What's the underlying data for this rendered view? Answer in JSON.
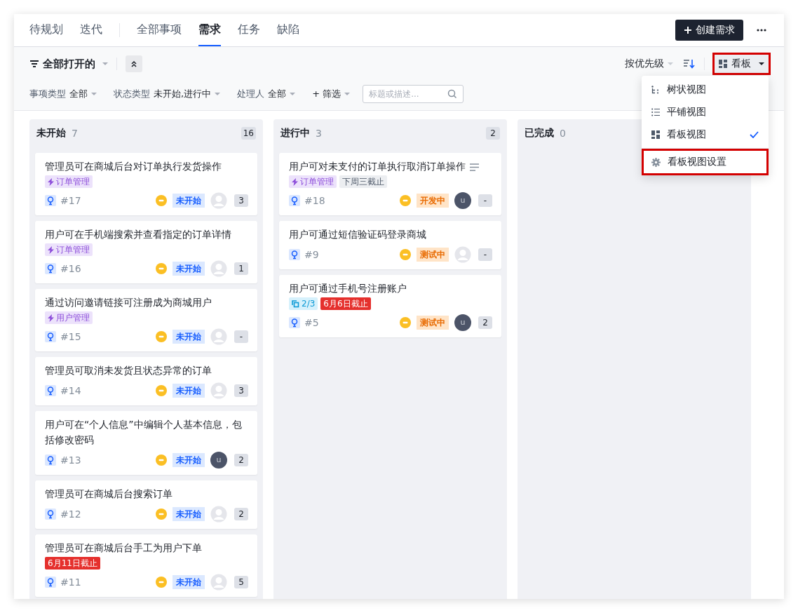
{
  "nav": {
    "left_tabs": [
      {
        "label": "待规划",
        "selected": false
      },
      {
        "label": "迭代",
        "selected": false
      }
    ],
    "type_tabs": [
      {
        "label": "全部事项",
        "selected": false
      },
      {
        "label": "需求",
        "selected": true
      },
      {
        "label": "任务",
        "selected": false
      },
      {
        "label": "缺陷",
        "selected": false
      }
    ],
    "create_button": "创建需求"
  },
  "toolbar": {
    "view_filter": "全部打开的",
    "filters": [
      {
        "label": "事项类型",
        "value": "全部"
      },
      {
        "label": "状态类型",
        "value": "未开始,进行中"
      },
      {
        "label": "处理人",
        "value": "全部"
      }
    ],
    "add_filter": "+ 筛选",
    "search": {
      "placeholder": "标题或描述..."
    },
    "sort": "按优先级",
    "view_button": "看板",
    "view_button_highlighted": true
  },
  "view_menu": {
    "items": [
      {
        "label": "树状视图",
        "kind": "tree",
        "selected": false
      },
      {
        "label": "平铺视图",
        "kind": "list",
        "selected": false
      },
      {
        "label": "看板视图",
        "kind": "board",
        "selected": true
      }
    ],
    "settings": {
      "label": "看板视图设置",
      "highlighted": true
    }
  },
  "columns": [
    {
      "title": "未开始",
      "count": "7",
      "badge": "16",
      "cards": [
        {
          "title": "管理员可在商城后台对订单执行发货操作",
          "has_description": false,
          "tags": [
            {
              "kind": "epic",
              "text": "订单管理"
            }
          ],
          "id": "#17",
          "status": {
            "text": "未开始",
            "kind": "todo"
          },
          "assignee": {
            "kind": "empty"
          },
          "count": "3"
        },
        {
          "title": "用户可在手机端搜索并查看指定的订单详情",
          "has_description": false,
          "tags": [
            {
              "kind": "epic",
              "text": "订单管理"
            }
          ],
          "id": "#16",
          "status": {
            "text": "未开始",
            "kind": "todo"
          },
          "assignee": {
            "kind": "empty"
          },
          "count": "1"
        },
        {
          "title": "通过访问邀请链接可注册成为商城用户",
          "has_description": false,
          "tags": [
            {
              "kind": "epic",
              "text": "用户管理"
            }
          ],
          "id": "#15",
          "status": {
            "text": "未开始",
            "kind": "todo"
          },
          "assignee": {
            "kind": "empty"
          },
          "count": "-"
        },
        {
          "title": "管理员可取消未发货且状态异常的订单",
          "has_description": false,
          "id": "#14",
          "status": {
            "text": "未开始",
            "kind": "todo"
          },
          "assignee": {
            "kind": "empty"
          },
          "count": "3"
        },
        {
          "title": "用户可在“个人信息”中编辑个人基本信息，包括修改密码",
          "has_description": false,
          "id": "#13",
          "status": {
            "text": "未开始",
            "kind": "todo"
          },
          "assignee": {
            "kind": "user",
            "initial": "u"
          },
          "count": "2"
        },
        {
          "title": "管理员可在商城后台搜索订单",
          "has_description": false,
          "id": "#12",
          "status": {
            "text": "未开始",
            "kind": "todo"
          },
          "assignee": {
            "kind": "empty"
          },
          "count": "2"
        },
        {
          "title": "管理员可在商城后台手工为用户下单",
          "has_description": false,
          "tags": [
            {
              "kind": "overdue",
              "text": "6月11日截止"
            }
          ],
          "id": "#11",
          "status": {
            "text": "未开始",
            "kind": "todo"
          },
          "assignee": {
            "kind": "empty"
          },
          "count": "5"
        }
      ]
    },
    {
      "title": "进行中",
      "count": "3",
      "badge": "2",
      "cards": [
        {
          "title": "用户可对未支付的订单执行取消订单操作",
          "has_description": true,
          "tags": [
            {
              "kind": "epic",
              "text": "订单管理"
            },
            {
              "kind": "due",
              "text": "下周三截止"
            }
          ],
          "id": "#18",
          "status": {
            "text": "开发中",
            "kind": "doing"
          },
          "assignee": {
            "kind": "user",
            "initial": "u"
          },
          "count": "-"
        },
        {
          "title": "用户可通过短信验证码登录商城",
          "has_description": false,
          "id": "#9",
          "status": {
            "text": "测试中",
            "kind": "doing"
          },
          "assignee": {
            "kind": "empty"
          },
          "count": "-"
        },
        {
          "title": "用户可通过手机号注册账户",
          "has_description": false,
          "tags": [
            {
              "kind": "subtasks",
              "text": "2/3"
            },
            {
              "kind": "overdue",
              "text": "6月6日截止"
            }
          ],
          "id": "#5",
          "status": {
            "text": "测试中",
            "kind": "doing"
          },
          "assignee": {
            "kind": "user",
            "initial": "u"
          },
          "count": "2"
        }
      ]
    },
    {
      "title": "已完成",
      "count": "0"
    }
  ]
}
